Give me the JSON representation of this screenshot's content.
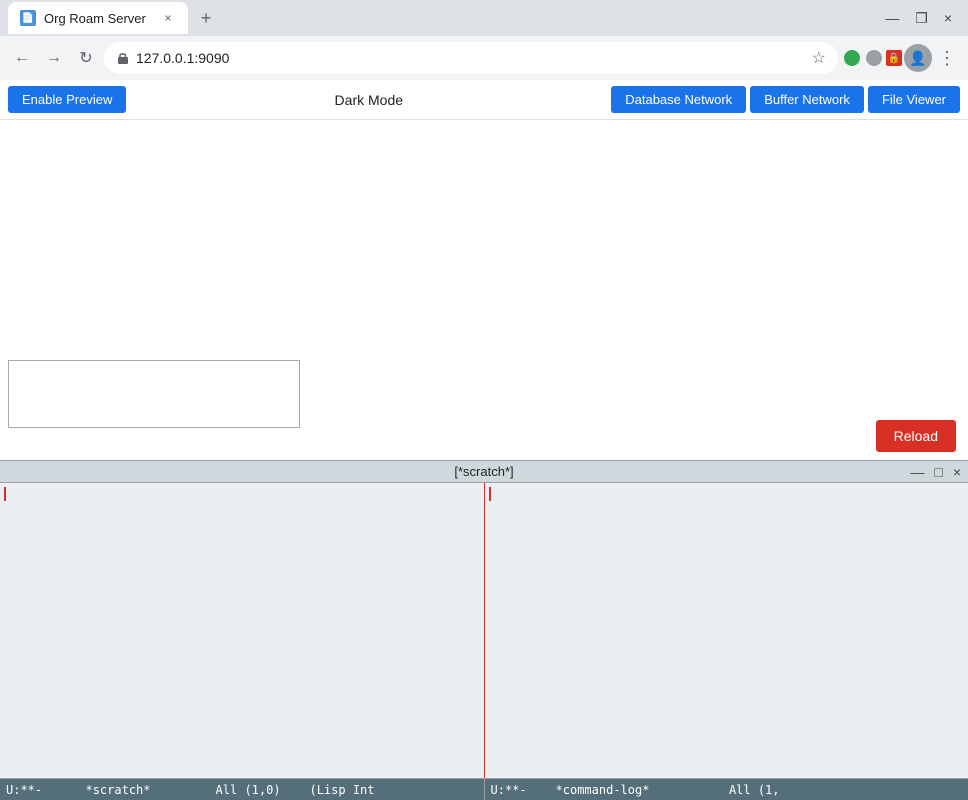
{
  "browser": {
    "tab_title": "Org Roam Server",
    "tab_close": "×",
    "new_tab": "+",
    "address": "127.0.0.1:9090",
    "minimize": "—",
    "maximize": "❐",
    "close": "×"
  },
  "toolbar": {
    "enable_preview": "Enable Preview",
    "dark_mode": "Dark Mode",
    "database_network": "Database Network",
    "buffer_network": "Buffer Network",
    "file_viewer": "File Viewer"
  },
  "reload_button": "Reload",
  "emacs": {
    "title": "[*scratch*]",
    "minimize": "—",
    "maximize": "□",
    "close": "×",
    "status_left": "U:**-        *scratch*          All (1,0)",
    "status_left_part1": "U:**-",
    "status_left_part2": "*scratch*",
    "status_left_part3": "All (1,0)",
    "status_left_part4": "(Lisp Int",
    "status_right_part1": "U:**-",
    "status_right_part2": "*command-log*",
    "status_right_part3": "All (1,"
  }
}
